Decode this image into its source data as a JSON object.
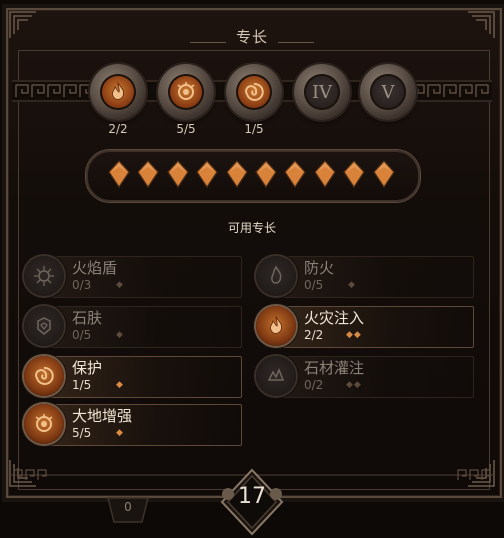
{
  "header": {
    "title": "专长"
  },
  "ranks": [
    {
      "label": "2/2",
      "icon": "flame-spiral-icon",
      "unlocked": true
    },
    {
      "label": "5/5",
      "icon": "earth-eye-icon",
      "unlocked": true
    },
    {
      "label": "1/5",
      "icon": "swirl-shield-icon",
      "unlocked": true
    },
    {
      "numeral": "IV",
      "icon": "locked-rank-icon",
      "unlocked": false
    },
    {
      "numeral": "V",
      "icon": "locked-rank-icon",
      "unlocked": false
    }
  ],
  "points": {
    "total": 10,
    "filled": 10,
    "color": "#d9823a"
  },
  "available": {
    "title": "可用专长"
  },
  "specs": [
    {
      "name": "火焰盾",
      "rank": "0/3",
      "cost": "◆",
      "active": false,
      "icon": "fire-shield-icon"
    },
    {
      "name": "防火",
      "rank": "0/5",
      "cost": "◆",
      "active": false,
      "icon": "fire-ward-icon"
    },
    {
      "name": "石肤",
      "rank": "0/5",
      "cost": "◆",
      "active": false,
      "icon": "stone-skin-icon"
    },
    {
      "name": "火灾注入",
      "rank": "2/2",
      "cost": "◆◆",
      "active": true,
      "icon": "fire-infusion-icon"
    },
    {
      "name": "保护",
      "rank": "1/5",
      "cost": "◆",
      "active": true,
      "icon": "protection-icon"
    },
    {
      "name": "石材灌注",
      "rank": "0/2",
      "cost": "◆◆",
      "active": false,
      "icon": "stone-infusion-icon"
    },
    {
      "name": "大地增强",
      "rank": "5/5",
      "cost": "◆",
      "active": true,
      "icon": "earth-empower-icon"
    }
  ],
  "footer": {
    "level": "17",
    "secondary": "0"
  },
  "colors": {
    "accent": "#d9823a",
    "frame": "#5a4a3c",
    "text": "#e8dccb"
  }
}
